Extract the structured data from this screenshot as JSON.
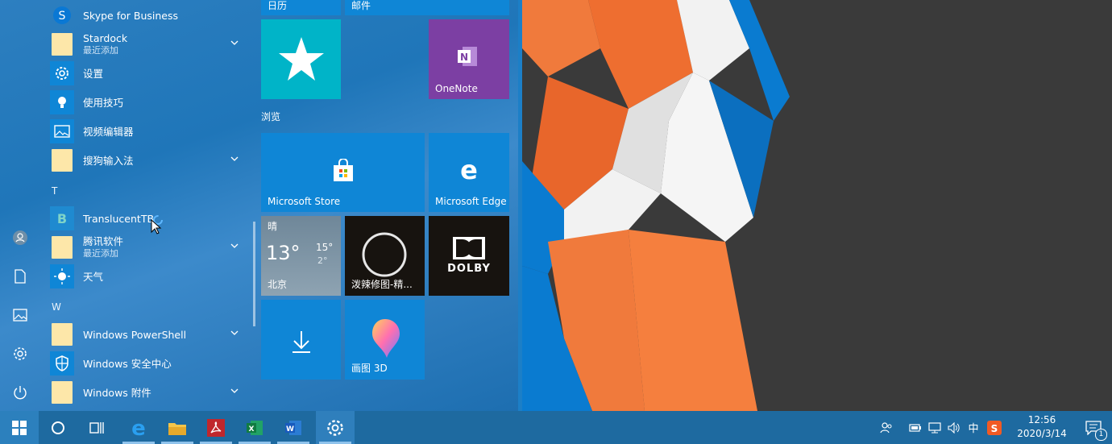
{
  "colors": {
    "accent": "#0f86d6",
    "taskbar": "#1e6aa0",
    "tile_teal": "#00b4c8",
    "tile_onenote": "#7c3fa3",
    "tile_dark": "#17130f",
    "wallpaper_orange": "#f07a3c",
    "wallpaper_blue": "#0a7bd0"
  },
  "app_list": {
    "items": [
      {
        "name": "Skype for Business",
        "sub": "",
        "icon": "skype-icon",
        "expandable": false
      },
      {
        "name": "Stardock",
        "sub": "最近添加",
        "icon": "folder-icon",
        "expandable": true
      },
      {
        "name": "设置",
        "sub": "",
        "icon": "gear-icon",
        "expandable": false
      },
      {
        "name": "使用技巧",
        "sub": "",
        "icon": "lightbulb-icon",
        "expandable": false
      },
      {
        "name": "视频编辑器",
        "sub": "",
        "icon": "photos-icon",
        "expandable": false
      },
      {
        "name": "搜狗输入法",
        "sub": "",
        "icon": "folder-icon",
        "expandable": true
      },
      {
        "name": "TranslucentTB",
        "sub": "",
        "icon": "translucenttb-icon",
        "expandable": false
      },
      {
        "name": "腾讯软件",
        "sub": "最近添加",
        "icon": "folder-icon",
        "expandable": true
      },
      {
        "name": "天气",
        "sub": "",
        "icon": "sun-icon",
        "expandable": false
      },
      {
        "name": "Windows PowerShell",
        "sub": "",
        "icon": "folder-icon",
        "expandable": true
      },
      {
        "name": "Windows 安全中心",
        "sub": "",
        "icon": "shield-icon",
        "expandable": false
      },
      {
        "name": "Windows 附件",
        "sub": "",
        "icon": "folder-icon",
        "expandable": true
      }
    ],
    "letters": [
      "T",
      "W"
    ]
  },
  "tiles": {
    "top_labels": [
      "日历",
      "邮件"
    ],
    "group_browse": "浏览",
    "onenote": "OneNote",
    "store": "Microsoft Store",
    "edge": "Microsoft Edge",
    "weather": {
      "condition": "晴",
      "temp": "13°",
      "high": "15°",
      "low": "2°",
      "city": "北京"
    },
    "photo_app": "泼辣修图-精...",
    "dolby": "DOLBY",
    "paint3d": "画图 3D"
  },
  "tray": {
    "ime": "中",
    "time": "12:56",
    "date": "2020/3/14",
    "notifications": "1"
  }
}
